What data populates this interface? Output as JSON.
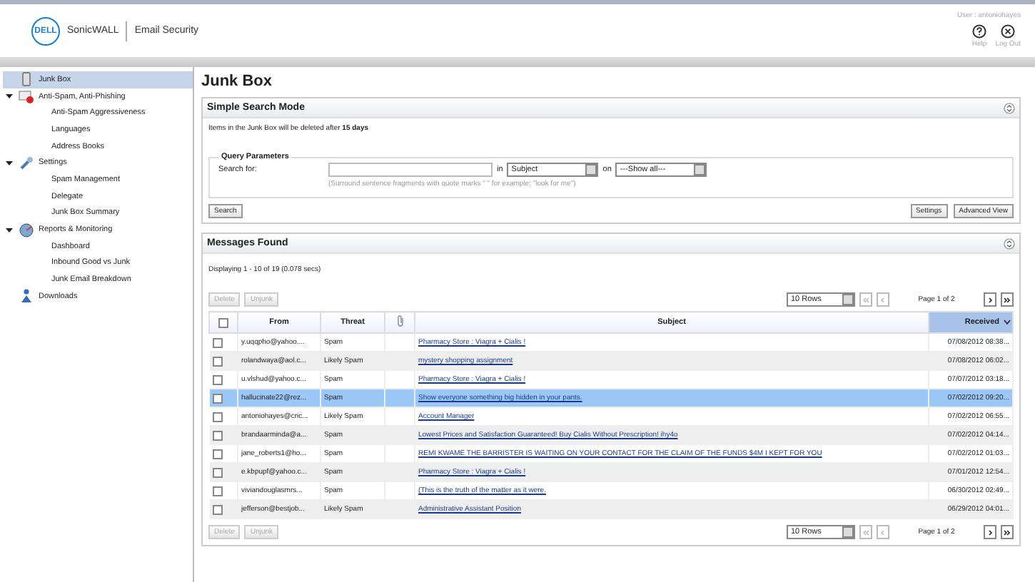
{
  "header": {
    "logo": "DELL",
    "product": "SonicWALL",
    "app": "Email Security",
    "user": "User : antoniohayes",
    "actions": [
      {
        "kind": "help",
        "label": "Help"
      },
      {
        "kind": "logout",
        "label": "Log Out"
      }
    ]
  },
  "sidebar": {
    "items": [
      {
        "label": "Junk Box",
        "kind": "junk",
        "selected": true
      },
      {
        "label": "Anti-Spam, Anti-Phishing",
        "kind": "antispam",
        "selected": false,
        "expanded": true,
        "children": [
          {
            "label": "Anti-Spam Aggressiveness",
            "selected": false
          },
          {
            "label": "Languages",
            "selected": false
          },
          {
            "label": "Address Books",
            "selected": false
          }
        ]
      },
      {
        "label": "Settings",
        "kind": "settings",
        "selected": false,
        "expanded": true,
        "children": [
          {
            "label": "Spam Management",
            "selected": false
          },
          {
            "label": "Delegate",
            "selected": false
          },
          {
            "label": "Junk Box Summary",
            "selected": false
          }
        ]
      },
      {
        "label": "Reports & Monitoring",
        "kind": "reports",
        "selected": false,
        "expanded": true,
        "children": [
          {
            "label": "Dashboard",
            "selected": false
          },
          {
            "label": "Inbound Good vs Junk",
            "selected": false
          },
          {
            "label": "Junk Email Breakdown",
            "selected": false
          }
        ]
      },
      {
        "label": "Downloads",
        "kind": "downloads",
        "selected": false
      }
    ]
  },
  "page_title": "Junk Box",
  "search_panel": {
    "title": "Simple Search Mode",
    "notice": "Items in the Junk Box will be deleted after **15 days**",
    "group_title": "Query Parameters",
    "search_label": "Search for:",
    "in_label": "in",
    "field_select": "Subject",
    "on_label": "on",
    "scope_select": "---Show all---",
    "hint": "(Surround sentence fragments with quote marks \" \" for example; \"look for me\")",
    "left_buttons": [
      "Search"
    ],
    "right_buttons": [
      "Settings",
      "Advanced View"
    ]
  },
  "messages_panel": {
    "title": "Messages Found",
    "status": "Displaying 1 - 10 of 19 (0.078 secs)",
    "select_all_checked": false,
    "toolbars": [
      {
        "buttons": [
          {
            "label": "Delete",
            "disabled": true
          },
          {
            "label": "Unjunk",
            "disabled": true
          }
        ],
        "rows_select": "10 Rows",
        "page": "Page 1 of 2"
      },
      {
        "buttons": [
          {
            "label": "Delete",
            "disabled": true
          },
          {
            "label": "Unjunk",
            "disabled": true
          }
        ],
        "rows_select": "10 Rows",
        "page": "Page 1 of 2"
      }
    ],
    "columns": [
      {
        "label": "From",
        "sorted": false
      },
      {
        "label": "Threat",
        "sorted": false
      },
      {
        "label": "Subject",
        "sorted": false
      },
      {
        "label": "Received",
        "sorted": true
      }
    ],
    "rows": [
      {
        "from": "y.uqqpho@yahoo....",
        "threat": "Spam",
        "subject": "Pharmacy Store : Viagra + Cialis !",
        "received": "07/08/2012 08:38...",
        "checked": false,
        "selected": false
      },
      {
        "from": "rolandwaya@aol.c...",
        "threat": "Likely Spam",
        "subject": "mystery shopping assignment",
        "received": "07/08/2012 06:02...",
        "checked": false,
        "selected": false
      },
      {
        "from": "u.vlshud@yahoo.c...",
        "threat": "Spam",
        "subject": "Pharmacy Store : Viagra + Cialis !",
        "received": "07/07/2012 03:18...",
        "checked": false,
        "selected": false
      },
      {
        "from": "hallucinate22@rez...",
        "threat": "Spam",
        "subject": "Show everyone something big hidden in your pants.",
        "received": "07/02/2012 09:20...",
        "checked": false,
        "selected": true
      },
      {
        "from": "antoniohayes@cric...",
        "threat": "Likely Spam",
        "subject": "Account Manager",
        "received": "07/02/2012 06:55...",
        "checked": false,
        "selected": false
      },
      {
        "from": "brandaarminda@a...",
        "threat": "Spam",
        "subject": "Lowest Prices and Satisfaction Guaranteed! Buy Cialis Without Prescription! ihy4o",
        "received": "07/02/2012 04:14...",
        "checked": false,
        "selected": false
      },
      {
        "from": "jane_roberts1@ho...",
        "threat": "Spam",
        "subject": "REMI KWAME THE BARRISTER IS WAITING ON YOUR CONTACT FOR THE CLAIM OF THE FUNDS $4M I KEPT FOR YOU",
        "received": "07/02/2012 01:03...",
        "checked": false,
        "selected": false
      },
      {
        "from": "e.kbpupf@yahoo.c...",
        "threat": "Spam",
        "subject": "Pharmacy Store : Viagra + Cialis !",
        "received": "07/01/2012 12:54...",
        "checked": false,
        "selected": false
      },
      {
        "from": "viviandouglasmrs...",
        "threat": "Spam",
        "subject": "(This is the truth of the matter as it were.",
        "received": "06/30/2012 02:49...",
        "checked": false,
        "selected": false
      },
      {
        "from": "jefferson@bestjob...",
        "threat": "Likely Spam",
        "subject": "Administrative Assistant Position",
        "received": "06/29/2012 04:01...",
        "checked": false,
        "selected": false
      }
    ]
  }
}
